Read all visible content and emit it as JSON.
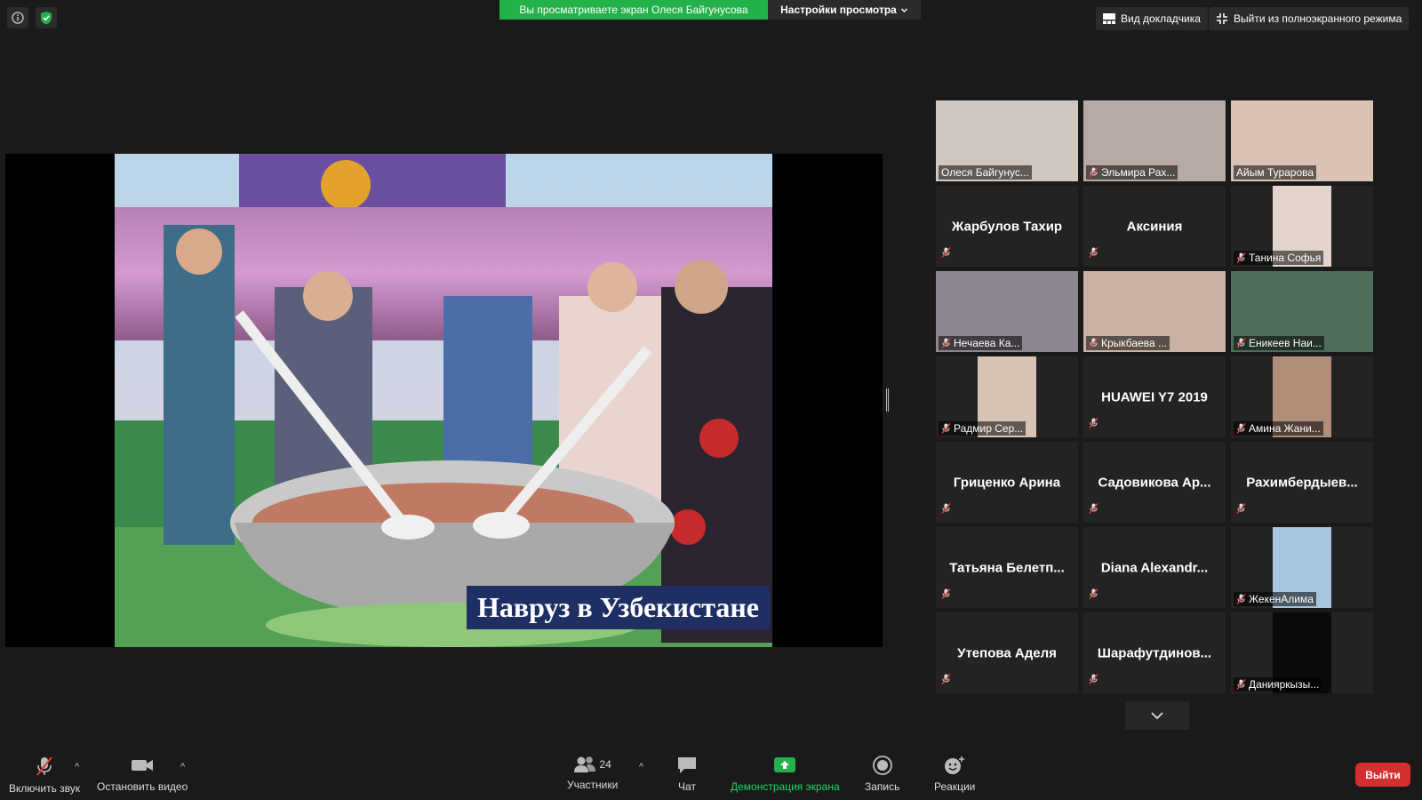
{
  "top_bar": {
    "share_banner": "Вы просматриваете экран Олеся Байгунусова",
    "view_settings": "Настройки просмотра",
    "speaker_view": "Вид докладчика",
    "exit_fullscreen": "Выйти из полноэкранного режима"
  },
  "shared_screen": {
    "caption": "Навруз в Узбекистане"
  },
  "participants": [
    {
      "name": "Олеся Байгунус...",
      "video": true,
      "muted": false,
      "active": true
    },
    {
      "name": "Эльмира Рах...",
      "video": true,
      "muted": true
    },
    {
      "name": "Айым Турарова",
      "video": true,
      "muted": false
    },
    {
      "name": "Жарбулов Тахир",
      "video": false,
      "muted": true
    },
    {
      "name": "Аксиния",
      "video": false,
      "muted": true
    },
    {
      "name": "Танина Софья",
      "video": true,
      "muted": true
    },
    {
      "name": "Нечаева Ка...",
      "video": true,
      "muted": true
    },
    {
      "name": "Крыкбаева ...",
      "video": true,
      "muted": true
    },
    {
      "name": "Еникеев Наи...",
      "video": true,
      "muted": true
    },
    {
      "name": "Радмир Сер...",
      "video": true,
      "muted": true
    },
    {
      "name": "HUAWEI Y7 2019",
      "video": false,
      "muted": true
    },
    {
      "name": "Амина Жани...",
      "video": true,
      "muted": true
    },
    {
      "name": "Гриценко Арина",
      "video": false,
      "muted": true
    },
    {
      "name": "Садовикова Ар...",
      "video": false,
      "muted": true
    },
    {
      "name": "Рахимбердыев...",
      "video": false,
      "muted": true
    },
    {
      "name": "Татьяна Белетп...",
      "video": false,
      "muted": true
    },
    {
      "name": "Diana Alexandr...",
      "video": false,
      "muted": true
    },
    {
      "name": "ЖекенАлима",
      "video": true,
      "muted": true
    },
    {
      "name": "Утепова Аделя",
      "video": false,
      "muted": true
    },
    {
      "name": "Шарафутдинов...",
      "video": false,
      "muted": true
    },
    {
      "name": "Данияркызы...",
      "video": true,
      "muted": true
    }
  ],
  "toolbar": {
    "unmute": "Включить звук",
    "stop_video": "Остановить видео",
    "participants": "Участники",
    "participants_count": "24",
    "chat": "Чат",
    "share_screen": "Демонстрация экрана",
    "record": "Запись",
    "reactions": "Реакции",
    "leave": "Выйти"
  },
  "colors": {
    "banner_green": "#23b24a",
    "active_speaker": "#ffe94d",
    "leave_red": "#d32f2f",
    "share_label_green": "#23d160"
  }
}
